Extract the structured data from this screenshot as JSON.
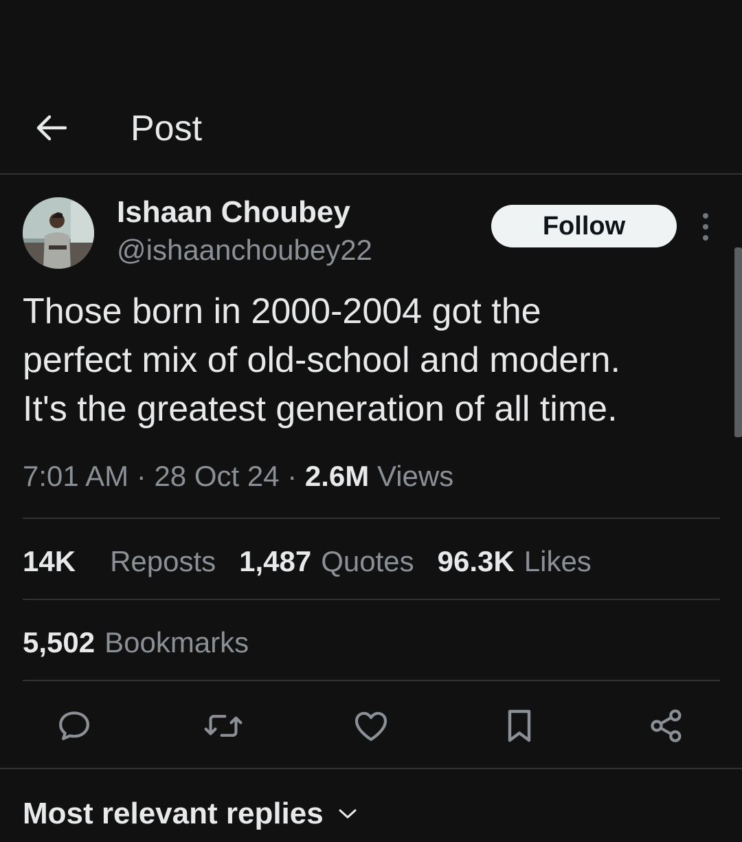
{
  "header": {
    "back_icon": "arrow-left-icon",
    "title": "Post"
  },
  "author": {
    "name": "Ishaan Choubey",
    "handle": "@ishaanchoubey22",
    "follow_label": "Follow",
    "more_icon": "more-vertical-icon"
  },
  "post": {
    "text": "Those born in 2000-2004 got the\nperfect mix of old-school and modern.\nIt's the greatest generation of all time.",
    "time": "7:01 AM",
    "date": "28 Oct 24",
    "views_count": "2.6M",
    "views_label": "Views",
    "separator": "·"
  },
  "stats": {
    "reposts_count": "14K",
    "reposts_label": "Reposts",
    "quotes_count": "1,487",
    "quotes_label": "Quotes",
    "likes_count": "96.3K",
    "likes_label": "Likes",
    "bookmarks_count": "5,502",
    "bookmarks_label": "Bookmarks"
  },
  "actions": [
    {
      "icon": "reply-icon"
    },
    {
      "icon": "repost-icon"
    },
    {
      "icon": "like-icon"
    },
    {
      "icon": "bookmark-icon"
    },
    {
      "icon": "share-icon"
    }
  ],
  "replies": {
    "sort_label": "Most relevant replies",
    "sort_icon": "chevron-down-icon"
  },
  "colors": {
    "background": "#111111",
    "text_primary": "#e7e9ea",
    "text_secondary": "#8b9096",
    "divider": "#2f3336",
    "follow_bg": "#eff3f4"
  }
}
